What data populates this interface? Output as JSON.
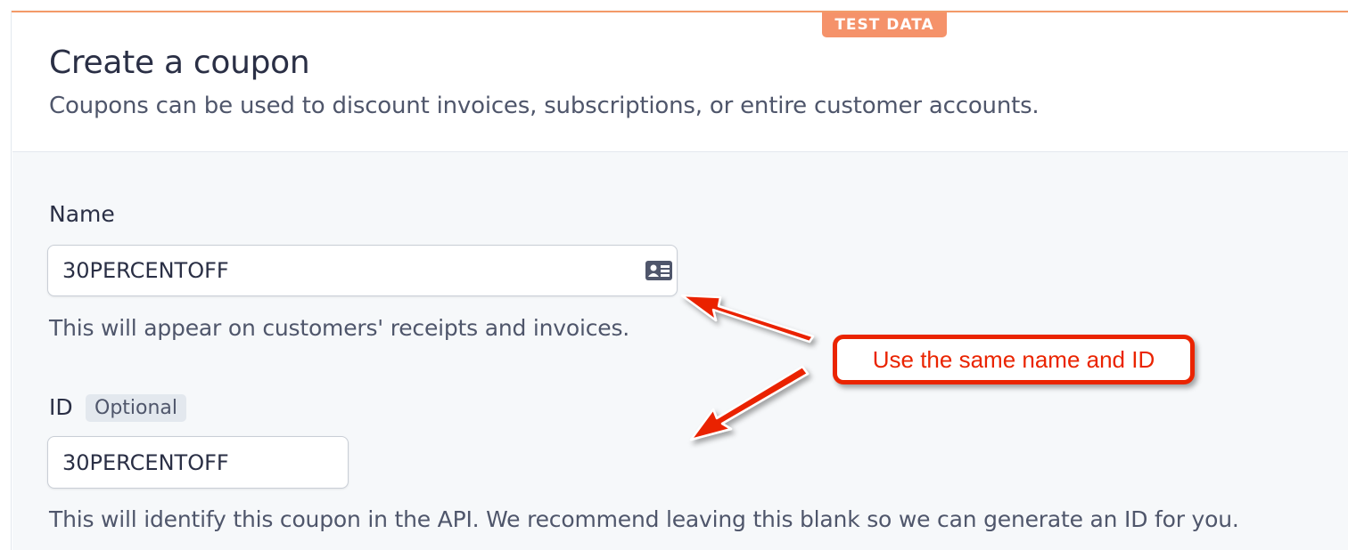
{
  "badge": {
    "label": "TEST DATA"
  },
  "header": {
    "title": "Create a coupon",
    "subtitle": "Coupons can be used to discount invoices, subscriptions, or entire customer accounts."
  },
  "form": {
    "name": {
      "label": "Name",
      "value": "30PERCENTOFF",
      "helper": "This will appear on customers' receipts and invoices.",
      "icon": "contact-card-icon"
    },
    "id": {
      "label": "ID",
      "optional_label": "Optional",
      "value": "30PERCENTOFF",
      "helper": "This will identify this coupon in the API. We recommend leaving this blank so we can generate an ID for you."
    }
  },
  "annotation": {
    "text": "Use the same name and ID",
    "color": "#ea2400"
  },
  "colors": {
    "accent": "#f5926a",
    "text_primary": "#2a2f45",
    "text_secondary": "#4f566b",
    "body_bg": "#f6f8fa"
  }
}
